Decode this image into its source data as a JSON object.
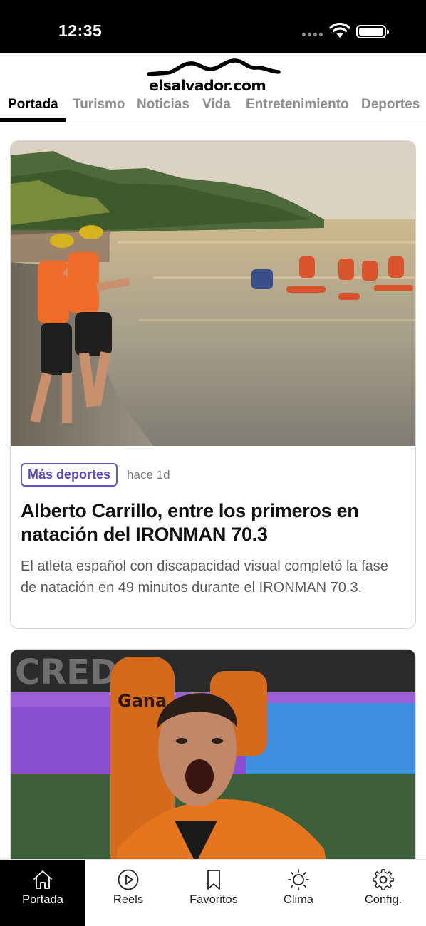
{
  "status_bar": {
    "time": "12:35"
  },
  "header": {
    "logo_text": "elsalvador.com"
  },
  "tabs": [
    {
      "label": "Portada",
      "active": true
    },
    {
      "label": "Turismo",
      "active": false
    },
    {
      "label": "Noticias",
      "active": false
    },
    {
      "label": "Vida",
      "active": false
    },
    {
      "label": "Entretenimiento",
      "active": false
    },
    {
      "label": "Deportes",
      "active": false
    }
  ],
  "articles": [
    {
      "category": "Más deportes",
      "time_ago": "hace 1d",
      "headline": "Alberto Carrillo, entre los primeros en natación del IRONMAN 70.3",
      "summary": "El atleta español con discapacidad visual completó la fase de natación en 49 minutos durante el IRONMAN 70.3."
    },
    {
      "image_text_jersey": "Gana",
      "image_text_wall": "CREDIT"
    }
  ],
  "bottom_nav": [
    {
      "label": "Portada",
      "icon": "home-icon",
      "active": true
    },
    {
      "label": "Reels",
      "icon": "play-icon",
      "active": false
    },
    {
      "label": "Favoritos",
      "icon": "bookmark-icon",
      "active": false
    },
    {
      "label": "Clima",
      "icon": "sun-icon",
      "active": false
    },
    {
      "label": "Config.",
      "icon": "gear-icon",
      "active": false
    }
  ],
  "colors": {
    "accent": "#5c48c0",
    "nav_active_bg": "#000000"
  }
}
